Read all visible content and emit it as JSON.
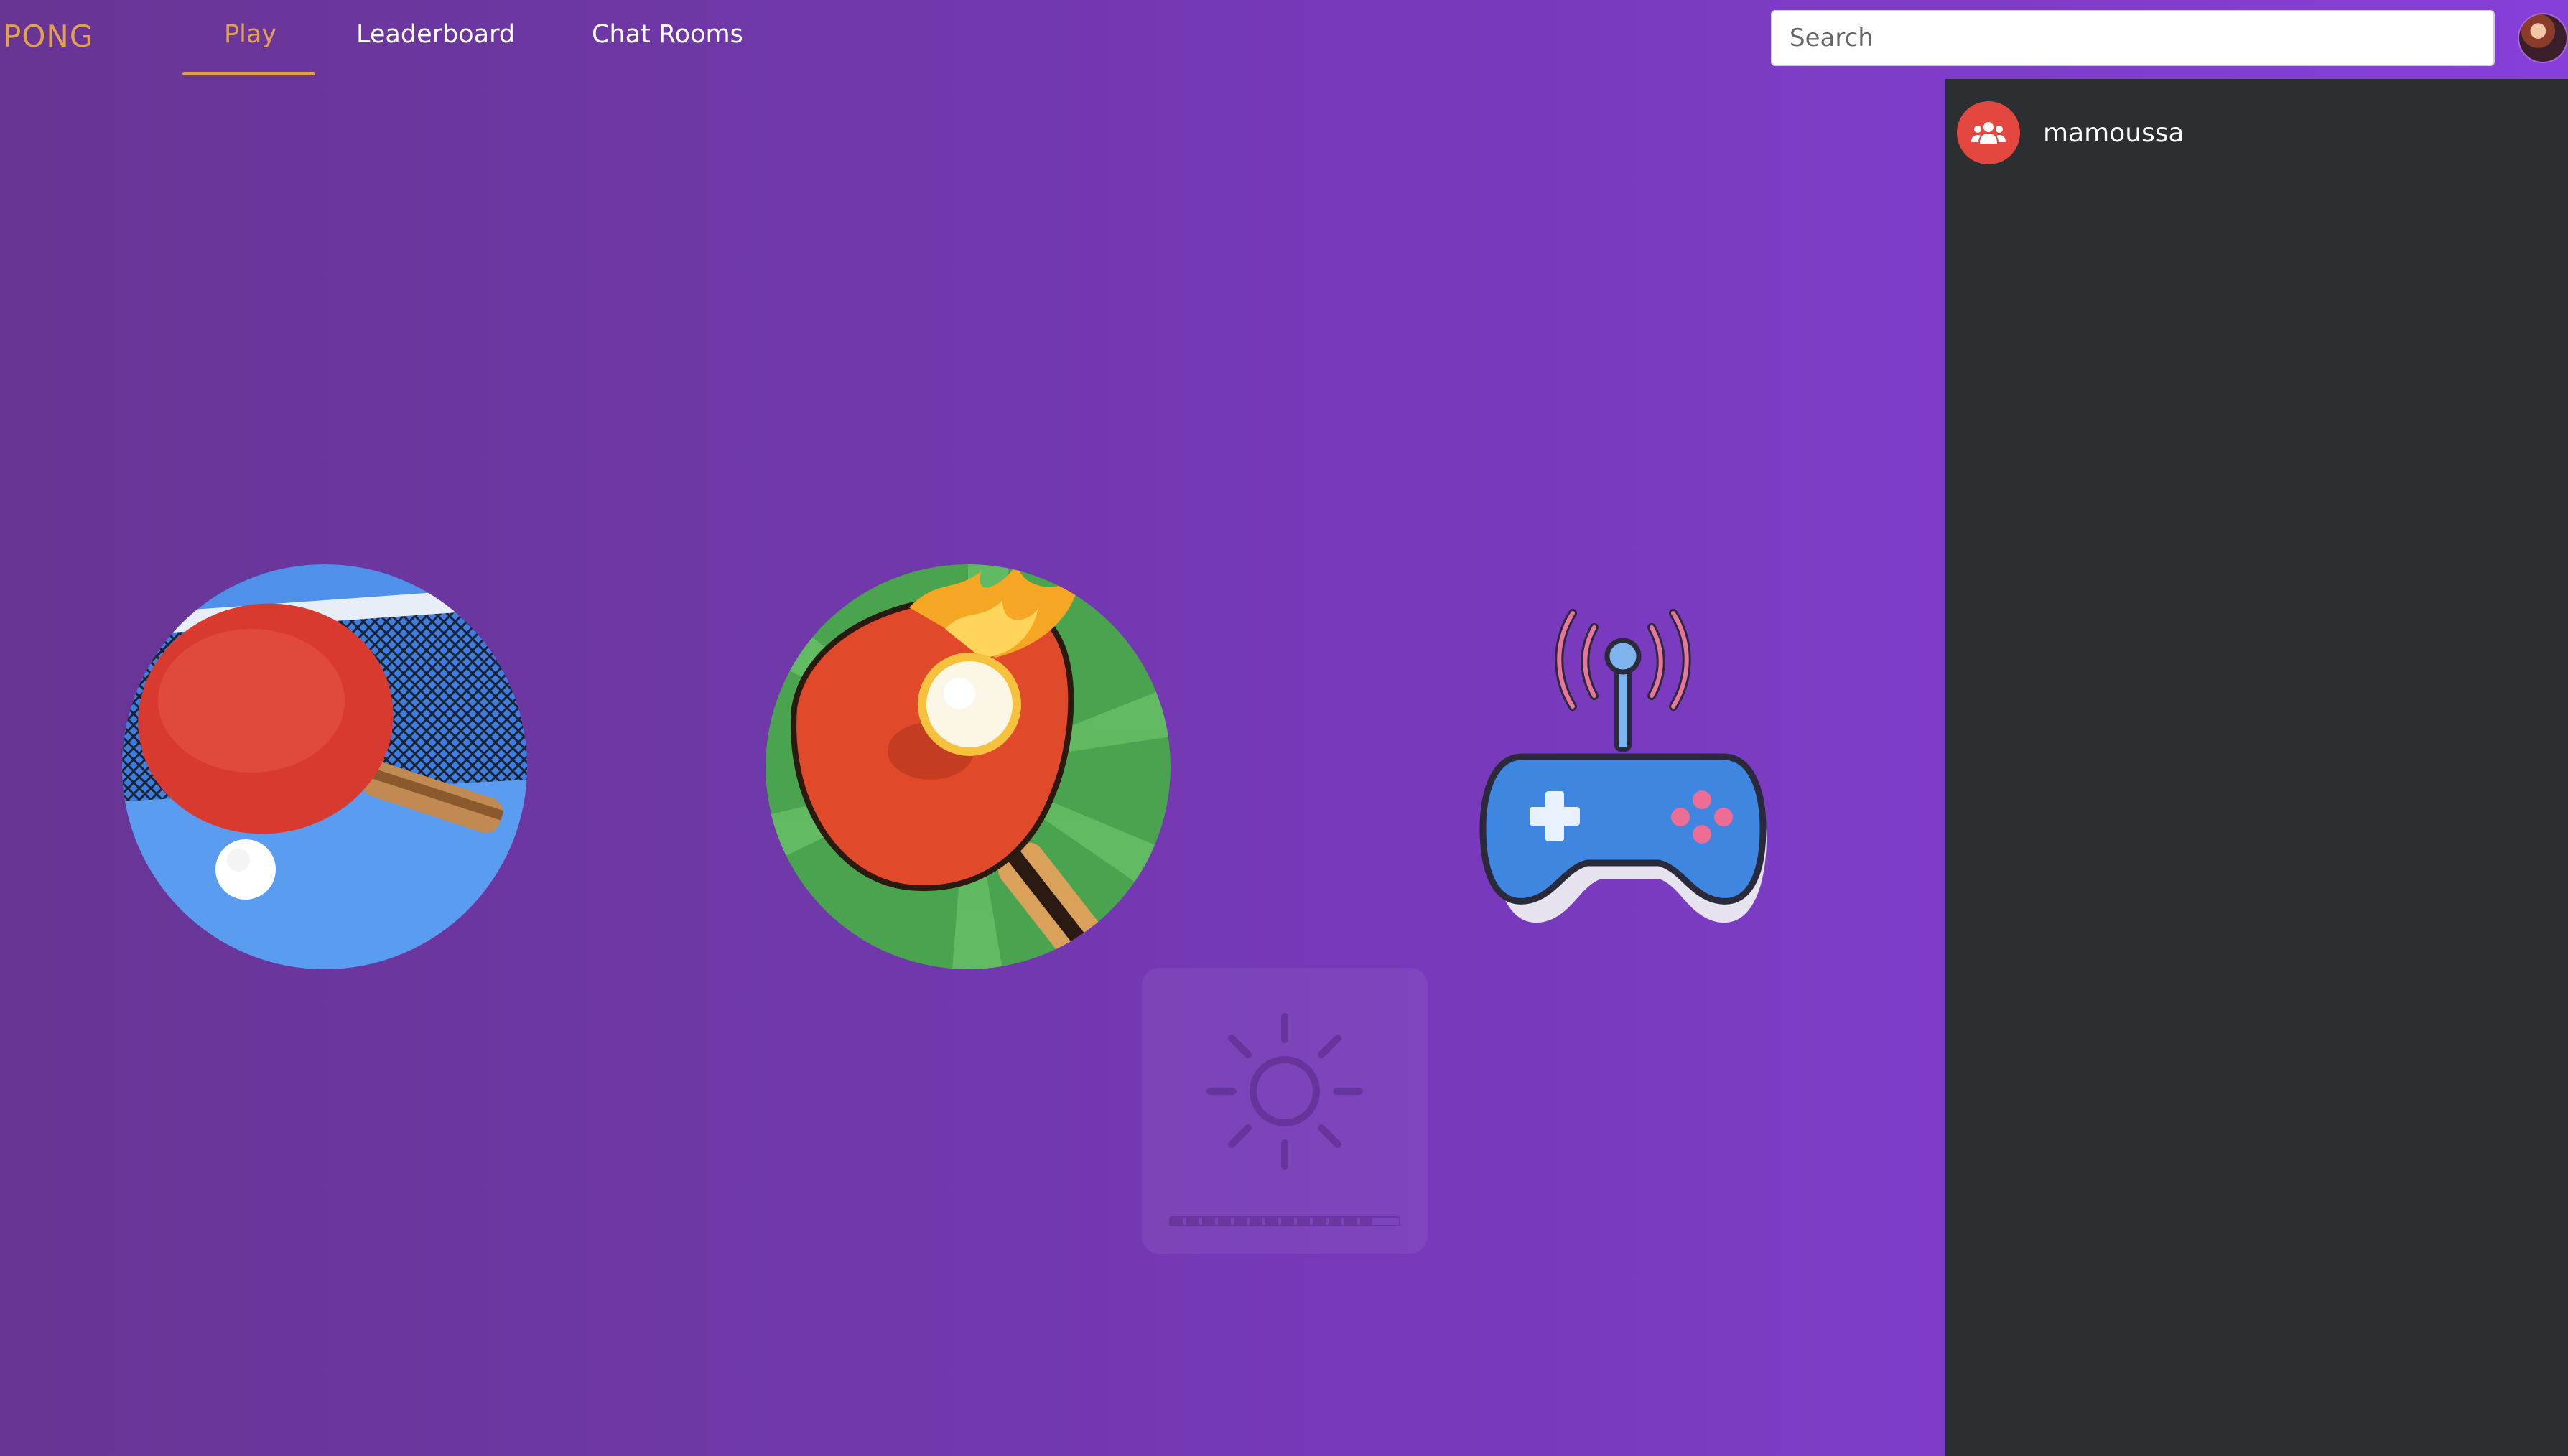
{
  "app": {
    "logo": "PONG"
  },
  "nav": {
    "tabs": [
      {
        "label": "Play",
        "active": true
      },
      {
        "label": "Leaderboard",
        "active": false
      },
      {
        "label": "Chat Rooms",
        "active": false
      }
    ]
  },
  "search": {
    "placeholder": "Search",
    "value": ""
  },
  "sidebar": {
    "rooms": [
      {
        "name": "mamoussa",
        "icon": "users-group-icon"
      }
    ]
  },
  "games": [
    {
      "icon": "table-tennis-paddle-net-icon"
    },
    {
      "icon": "fire-ping-pong-paddle-icon"
    },
    {
      "icon": "wireless-gamepad-icon"
    }
  ],
  "loader": {
    "icon": "sun-icon",
    "progress": 0.88
  },
  "colors": {
    "accent": "#e3a04f",
    "background_start": "#673594",
    "background_end": "#863fd9",
    "sidebar": "#2b2f31",
    "room_icon": "#e3473f"
  }
}
